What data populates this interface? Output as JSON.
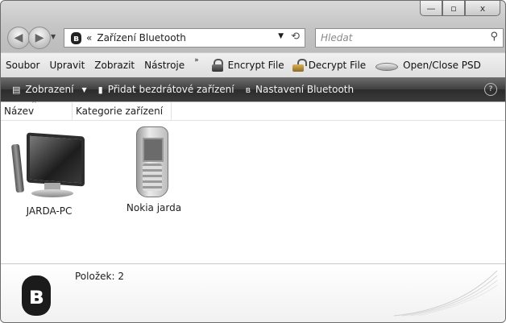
{
  "window": {
    "caption_buttons": {
      "minimize": "—",
      "maximize": "▫",
      "close": "x"
    }
  },
  "navigation": {
    "breadcrumb_separator": "«",
    "address_text": "Zařízení Bluetooth",
    "search_placeholder": "Hledat"
  },
  "menubar": {
    "items": [
      "Soubor",
      "Upravit",
      "Zobrazit",
      "Nástroje"
    ],
    "overflow": "»",
    "tools": [
      {
        "label": "Encrypt File",
        "icon": "lock-icon"
      },
      {
        "label": "Decrypt File",
        "icon": "open-lock-icon"
      },
      {
        "label": "Open/Close PSD",
        "icon": "disk-icon"
      }
    ]
  },
  "command_bar": {
    "items": [
      {
        "label": "Zobrazení",
        "icon": "views-icon",
        "dropdown": true
      },
      {
        "label": "Přidat bezdrátové zařízení",
        "icon": "add-device-icon"
      },
      {
        "label": "Nastavení Bluetooth",
        "icon": "bluetooth-icon"
      }
    ],
    "help": "?"
  },
  "columns": [
    "Název",
    "Kategorie zařízení"
  ],
  "items": [
    {
      "label": "JARDA-PC",
      "icon": "computer-icon"
    },
    {
      "label": "Nokia jarda",
      "icon": "phone-icon"
    }
  ],
  "details": {
    "count_text": "Položek: 2"
  }
}
